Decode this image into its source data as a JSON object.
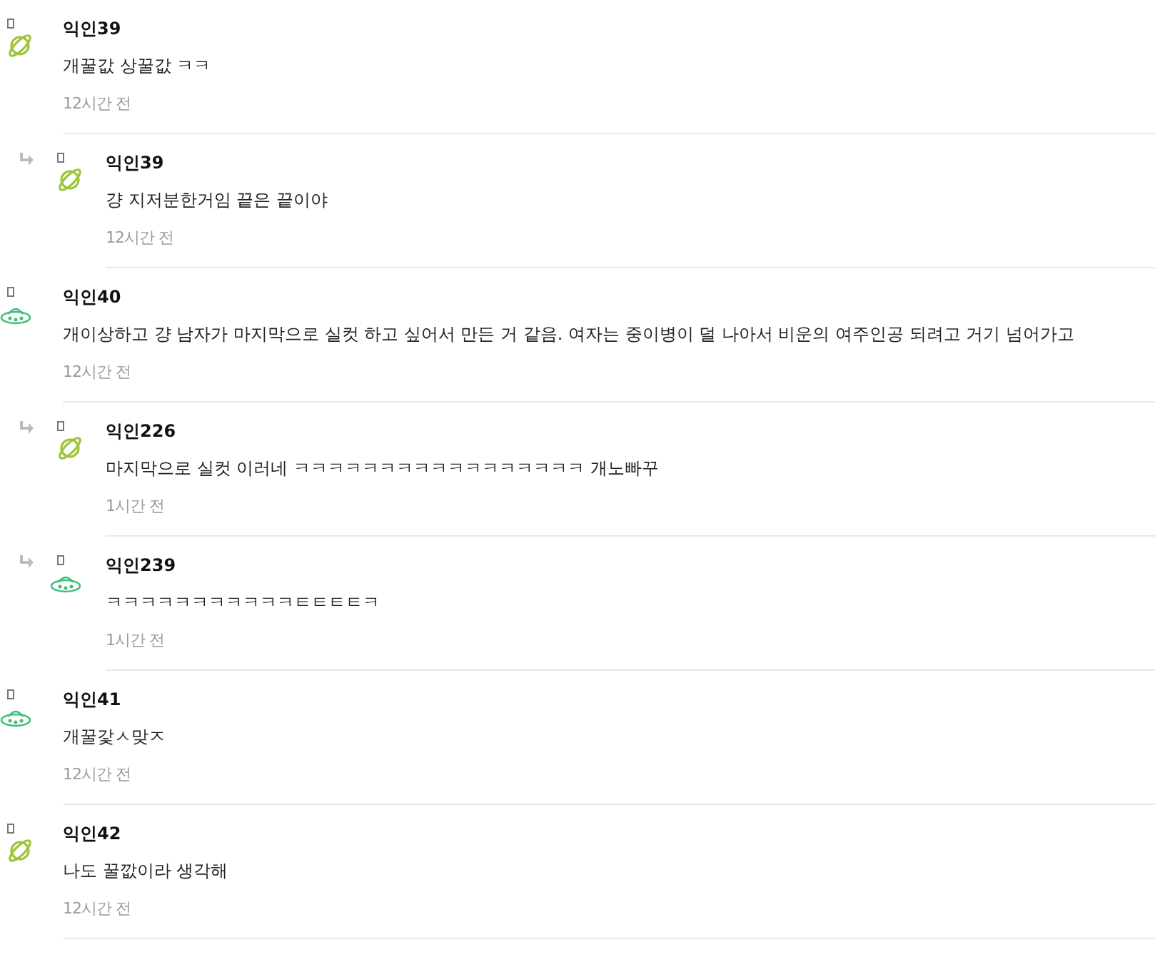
{
  "comments": [
    {
      "author": "익인39",
      "kind": "planet",
      "text": "개꿀값 상꿀값 ㅋㅋ",
      "time": "12시간 전",
      "replies": [
        {
          "author": "익인39",
          "kind": "planet",
          "text": "걍 지저분한거임 끝은 끝이야",
          "time": "12시간 전"
        }
      ]
    },
    {
      "author": "익인40",
      "kind": "ufo",
      "text": "개이상하고 걍 남자가 마지막으로 실컷 하고 싶어서 만든 거 같음. 여자는 중이병이 덜 나아서 비운의 여주인공 되려고 거기 넘어가고",
      "time": "12시간 전",
      "replies": [
        {
          "author": "익인226",
          "kind": "planet",
          "text": "마지막으로 실컷 이러네 ㅋㅋㅋㅋㅋㅋㅋㅋㅋㅋㅋㅋㅋㅋㅋㅋㅋ 개노빠꾸",
          "time": "1시간 전"
        },
        {
          "author": "익인239",
          "kind": "ufo",
          "text": "ㅋㅋㅋㅋㅋㅋㅋㅋㅋㅋㅋㅌㅌㅌㅌㅋ",
          "time": "1시간 전"
        }
      ]
    },
    {
      "author": "익인41",
      "kind": "ufo",
      "text": "개꿀갗ㅅ맞ㅈ",
      "time": "12시간 전"
    },
    {
      "author": "익인42",
      "kind": "planet",
      "text": "나도 꿀깞이라 생각해",
      "time": "12시간 전"
    }
  ]
}
